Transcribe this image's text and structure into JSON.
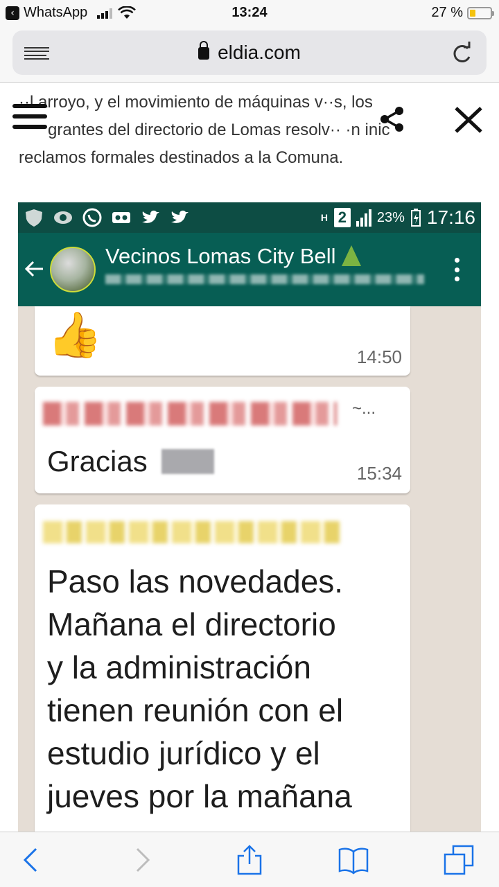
{
  "ios_status": {
    "back_app": "WhatsApp",
    "time": "13:24",
    "battery": "27 %",
    "battery_level": 0.27
  },
  "browser": {
    "domain": "eldia.com"
  },
  "article": {
    "lines": [
      "··l arroyo, y el movimiento de máquinas v··s, los",
      "grantes del directorio de Lomas resolv·· ·n inic",
      "reclamos formales destinados a la Comuna."
    ]
  },
  "screenshot": {
    "android_status": {
      "h_mark": "H",
      "sim_slot": "2",
      "battery": "23%",
      "time": "17:16"
    },
    "chat": {
      "group_name": "Vecinos Lomas City Bell",
      "messages": [
        {
          "content": "👍",
          "time": "14:50"
        },
        {
          "sender_suffix": "~...",
          "text": "Gracias",
          "time": "15:34"
        },
        {
          "text_lines": [
            "Paso las novedades.",
            "Mañana el directorio",
            "y la administración",
            "tienen reunión con el",
            "estudio jurídico y el",
            "jueves por la mañana"
          ]
        }
      ]
    }
  },
  "colors": {
    "whatsapp_dark": "#0d4d44",
    "whatsapp_toolbar": "#075e54",
    "chat_background": "#e5ddd5",
    "ios_blue": "#1a73e8"
  }
}
